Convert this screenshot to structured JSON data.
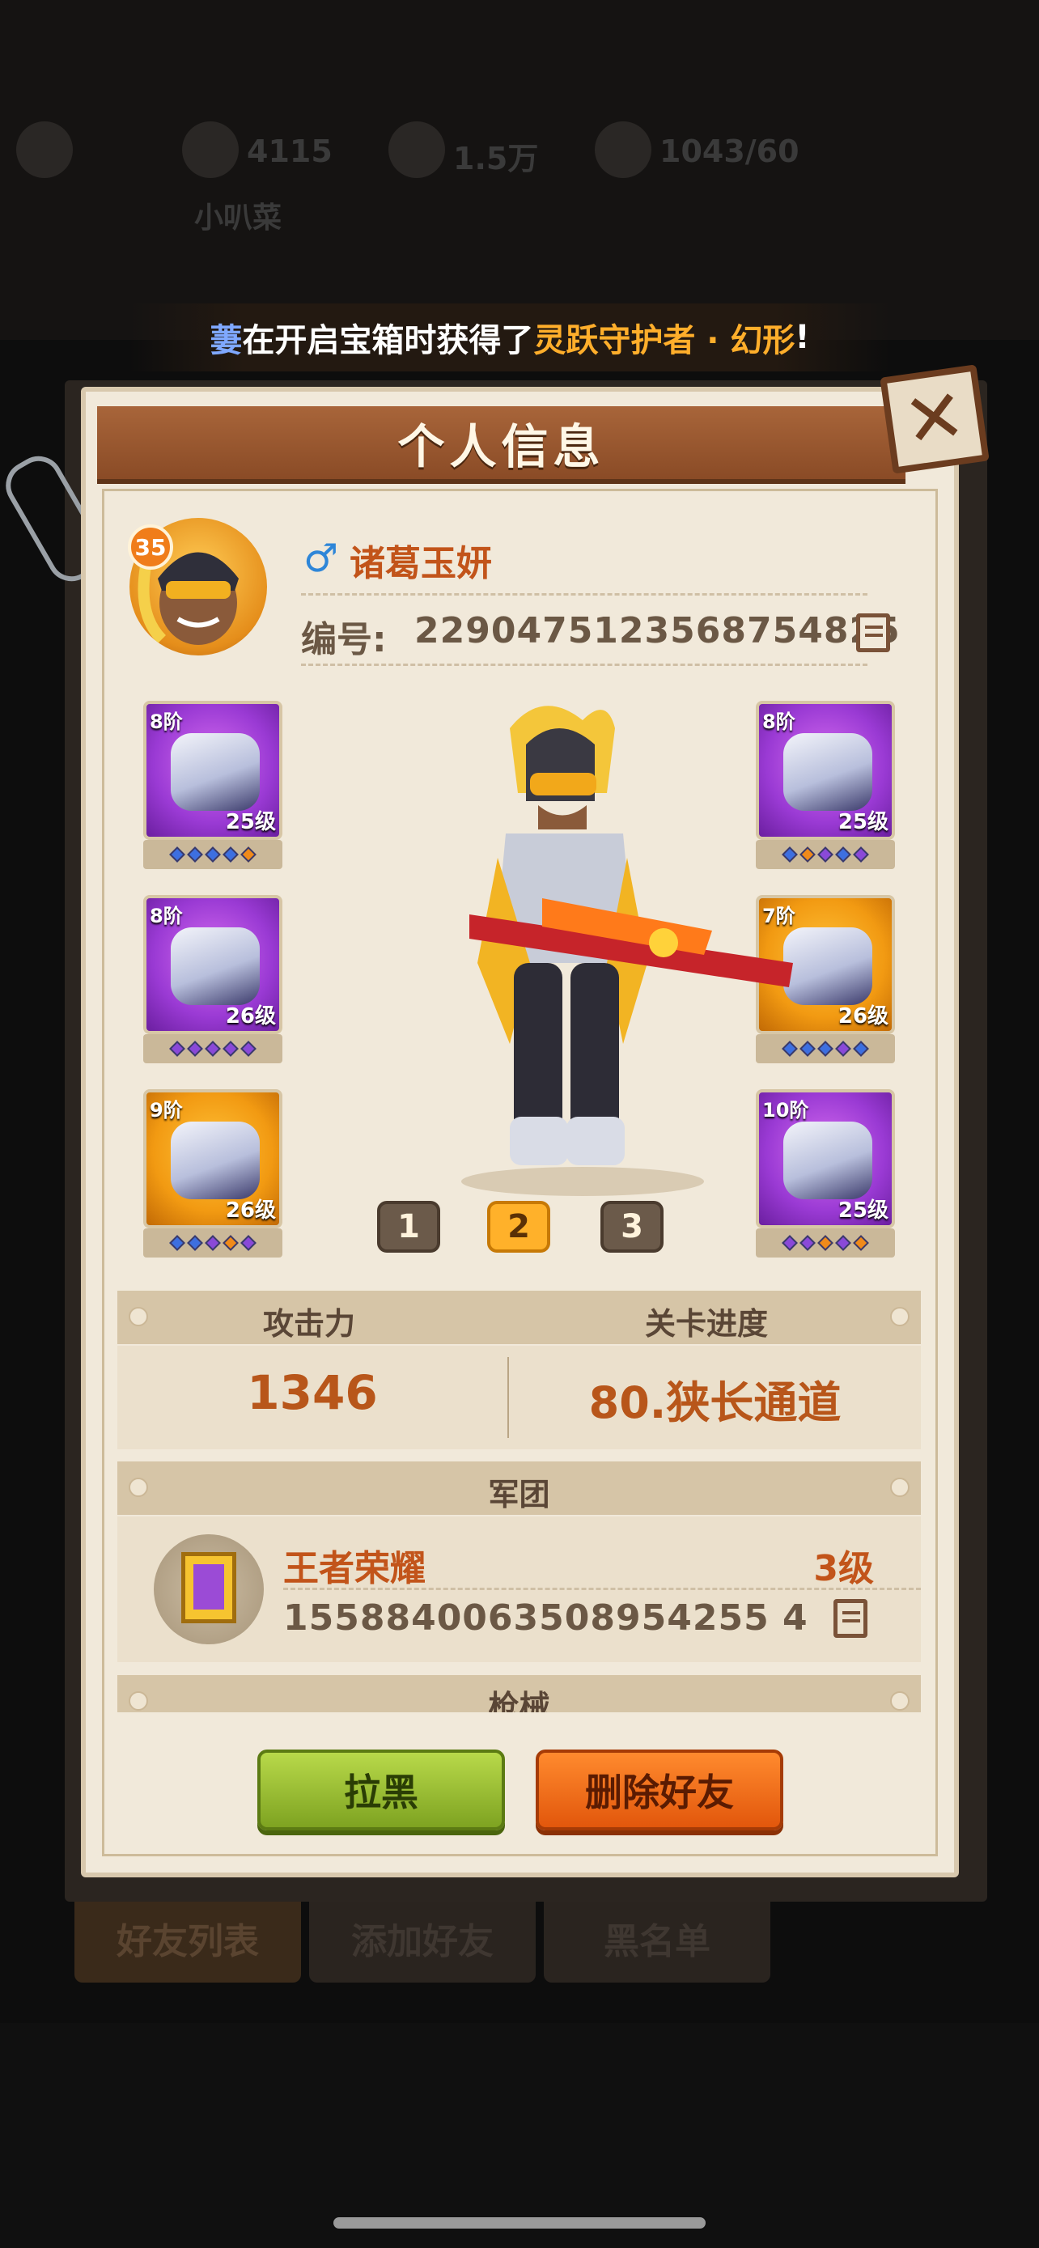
{
  "background": {
    "stats": [
      "4115",
      "1.5万",
      "1043/60"
    ],
    "username": "小叭菜",
    "tabs": [
      "好友列表",
      "添加好友",
      "黑名单"
    ]
  },
  "broadcast": {
    "prefix": "萋",
    "text_before": "在开启宝箱时获得了",
    "item": "灵跃守护者 · 幻形",
    "text_after": "!"
  },
  "panel": {
    "title": "个人信息",
    "close_glyph": "✕"
  },
  "profile": {
    "level": "35",
    "gender_symbol": "♂",
    "name": "诸葛玉妍",
    "id_label": "编号:",
    "id_value": "2290475123568754825"
  },
  "equipment": {
    "left": [
      {
        "tier": "8阶",
        "level": "25级",
        "rarity": "purple",
        "gems": [
          "blue",
          "blue",
          "blue",
          "blue",
          "orange"
        ]
      },
      {
        "tier": "8阶",
        "level": "26级",
        "rarity": "purple",
        "gems": [
          "purple",
          "purple",
          "purple",
          "purple",
          "purple"
        ]
      },
      {
        "tier": "9阶",
        "level": "26级",
        "rarity": "orange",
        "gems": [
          "blue",
          "blue",
          "purple",
          "orange",
          "purple"
        ]
      }
    ],
    "right": [
      {
        "tier": "8阶",
        "level": "25级",
        "rarity": "purple",
        "gems": [
          "blue",
          "orange",
          "purple",
          "blue",
          "purple"
        ]
      },
      {
        "tier": "7阶",
        "level": "26级",
        "rarity": "orange",
        "gems": [
          "blue",
          "blue",
          "blue",
          "purple",
          "blue"
        ]
      },
      {
        "tier": "10阶",
        "level": "25级",
        "rarity": "purple",
        "gems": [
          "purple",
          "purple",
          "orange",
          "purple",
          "orange"
        ]
      }
    ]
  },
  "loadouts": [
    "1",
    "2",
    "3"
  ],
  "loadout_selected": "2",
  "stats": {
    "attack_label": "攻击力",
    "attack_value": "1346",
    "progress_label": "关卡进度",
    "progress_value": "80.狭长通道"
  },
  "legion": {
    "header": "军团",
    "name": "王者荣耀",
    "level": "3级",
    "id": "1558840063508954255 4"
  },
  "weapons": {
    "header": "枪械"
  },
  "actions": {
    "block_label": "拉黑",
    "delete_label": "删除好友"
  },
  "colors": {
    "accent_orange": "#c2541a",
    "panel_bg": "#f1e9da",
    "title_bar": "#8a4b26",
    "block_green": "#7ea321",
    "delete_orange": "#e2570c"
  }
}
